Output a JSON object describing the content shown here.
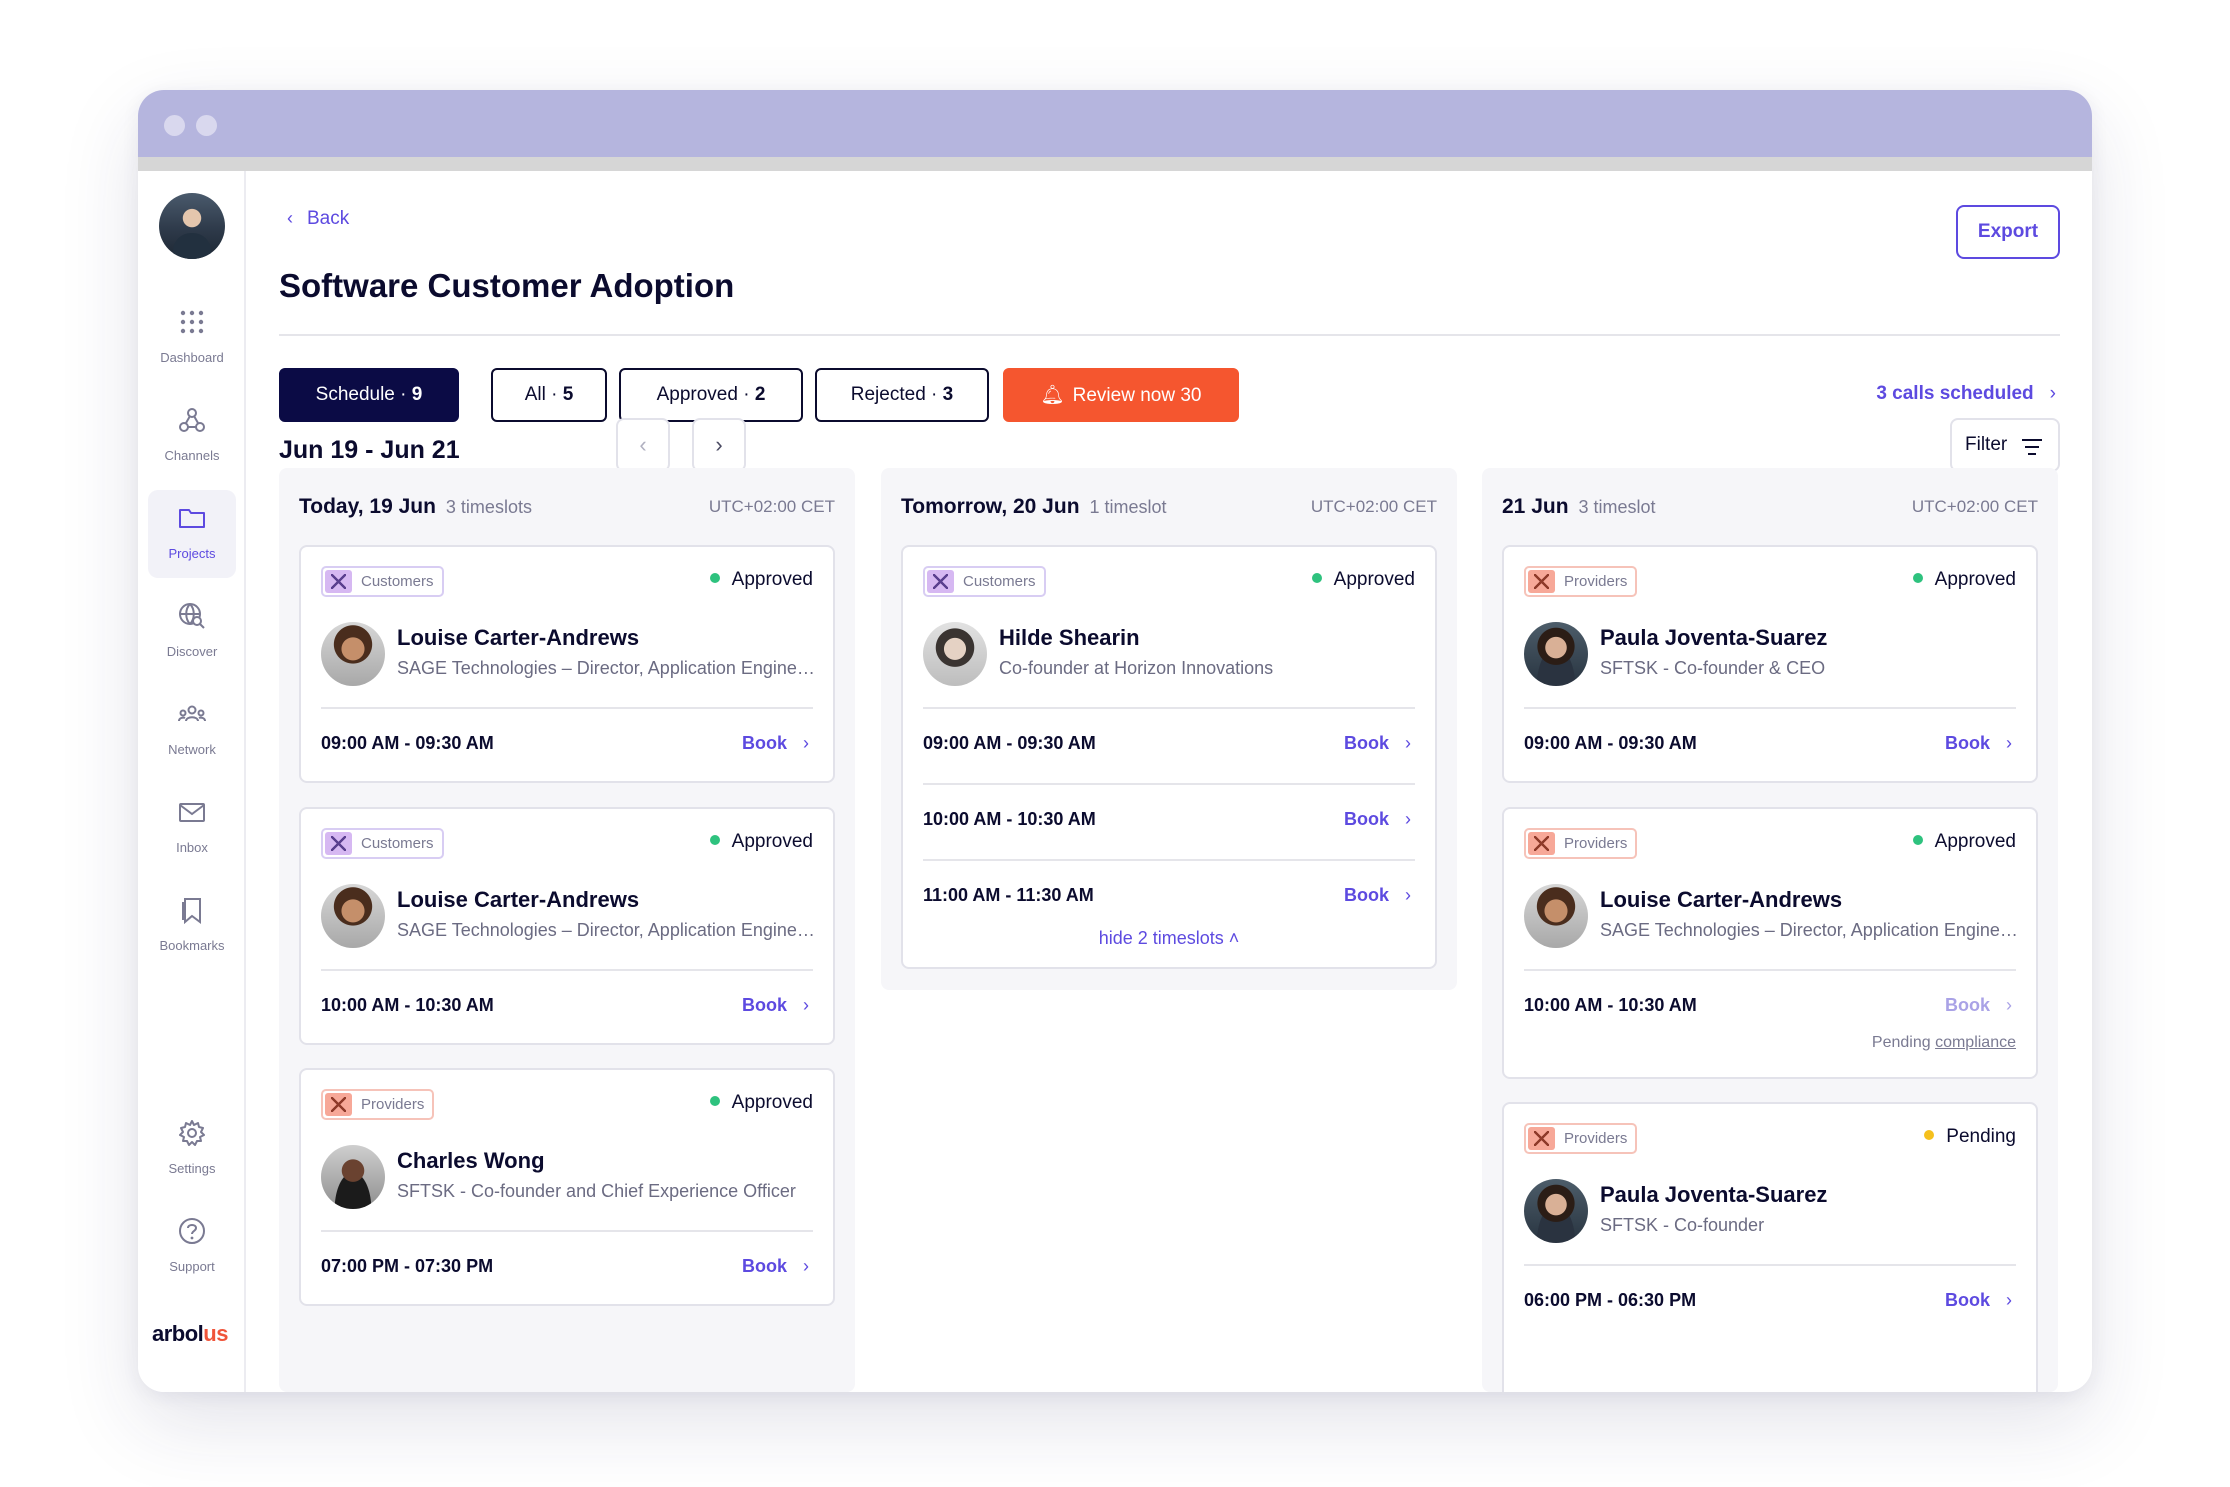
{
  "sidebar": {
    "items": [
      {
        "label": "Dashboard",
        "icon": "grid-dots-icon"
      },
      {
        "label": "Channels",
        "icon": "webhook-icon"
      },
      {
        "label": "Projects",
        "icon": "folder-icon"
      },
      {
        "label": "Discover",
        "icon": "globe-search-icon"
      },
      {
        "label": "Network",
        "icon": "people-icon"
      },
      {
        "label": "Inbox",
        "icon": "mail-icon"
      },
      {
        "label": "Bookmarks",
        "icon": "bookmark-icon"
      },
      {
        "label": "Settings",
        "icon": "gear-icon"
      },
      {
        "label": "Support",
        "icon": "help-circle-icon"
      }
    ],
    "logo_main": "arbol",
    "logo_accent": "us"
  },
  "header": {
    "back_label": "Back",
    "title": "Software Customer Adoption",
    "export_label": "Export"
  },
  "tabs": [
    {
      "label": "Schedule · ",
      "count": "9"
    },
    {
      "label": "All · ",
      "count": "5"
    },
    {
      "label": "Approved · ",
      "count": "2"
    },
    {
      "label": "Rejected · ",
      "count": "3"
    },
    {
      "label": "Review now  ",
      "count": "30"
    }
  ],
  "calls_link": "3 calls scheduled",
  "date_range": "Jun 19 - Jun 21",
  "filter_label": "Filter",
  "columns": [
    {
      "title": "Today, 19 Jun",
      "subtitle": "3 timeslots",
      "timezone": "UTC+02:00 CET",
      "cards": [
        {
          "tag": "Customers",
          "status": "Approved",
          "name": "Louise Carter-Andrews",
          "role": "SAGE Technologies – Director, Application Engineering",
          "slots": [
            {
              "time": "09:00 AM - 09:30 AM",
              "book": "Book"
            }
          ]
        },
        {
          "tag": "Customers",
          "status": "Approved",
          "name": "Louise Carter-Andrews",
          "role": "SAGE Technologies – Director, Application Engineering",
          "slots": [
            {
              "time": "10:00 AM - 10:30 AM",
              "book": "Book"
            }
          ]
        },
        {
          "tag": "Providers",
          "status": "Approved",
          "name": "Charles Wong",
          "role": "SFTSK - Co-founder and Chief Experience Officer",
          "slots": [
            {
              "time": "07:00 PM - 07:30 PM",
              "book": "Book"
            }
          ]
        }
      ]
    },
    {
      "title": "Tomorrow, 20 Jun",
      "subtitle": "1 timeslot",
      "timezone": "UTC+02:00 CET",
      "cards": [
        {
          "tag": "Customers",
          "status": "Approved",
          "name": "Hilde Shearin",
          "role": "Co-founder at Horizon Innovations",
          "slots": [
            {
              "time": "09:00 AM - 09:30 AM",
              "book": "Book"
            },
            {
              "time": "10:00 AM - 10:30 AM",
              "book": "Book"
            },
            {
              "time": "11:00 AM - 11:30 AM",
              "book": "Book"
            }
          ],
          "hide_label": "hide 2 timeslots"
        }
      ]
    },
    {
      "title": "21 Jun",
      "subtitle": "3 timeslot",
      "timezone": "UTC+02:00 CET",
      "cards": [
        {
          "tag": "Providers",
          "status": "Approved",
          "name": "Paula Joventa-Suarez",
          "role": "SFTSK - Co-founder & CEO",
          "slots": [
            {
              "time": "09:00 AM - 09:30 AM",
              "book": "Book"
            }
          ]
        },
        {
          "tag": "Providers",
          "status": "Approved",
          "name": "Louise Carter-Andrews",
          "role": "SAGE Technologies – Director, Application Engineering",
          "slots": [
            {
              "time": "10:00 AM - 10:30 AM",
              "book": "Book"
            }
          ],
          "pending_prefix": "Pending ",
          "pending_link": "compliance"
        },
        {
          "tag": "Providers",
          "status": "Pending",
          "name": "Paula Joventa-Suarez",
          "role": "SFTSK - Co-founder",
          "slots": [
            {
              "time": "06:00 PM - 06:30 PM",
              "book": "Book"
            }
          ]
        }
      ]
    }
  ],
  "colors": {
    "accent": "#5d4ae0",
    "navy": "#0b0b45",
    "alert": "#f5562f",
    "approved": "#2ec27e",
    "pending": "#f5c01d",
    "titlebar": "#b5b5de"
  }
}
